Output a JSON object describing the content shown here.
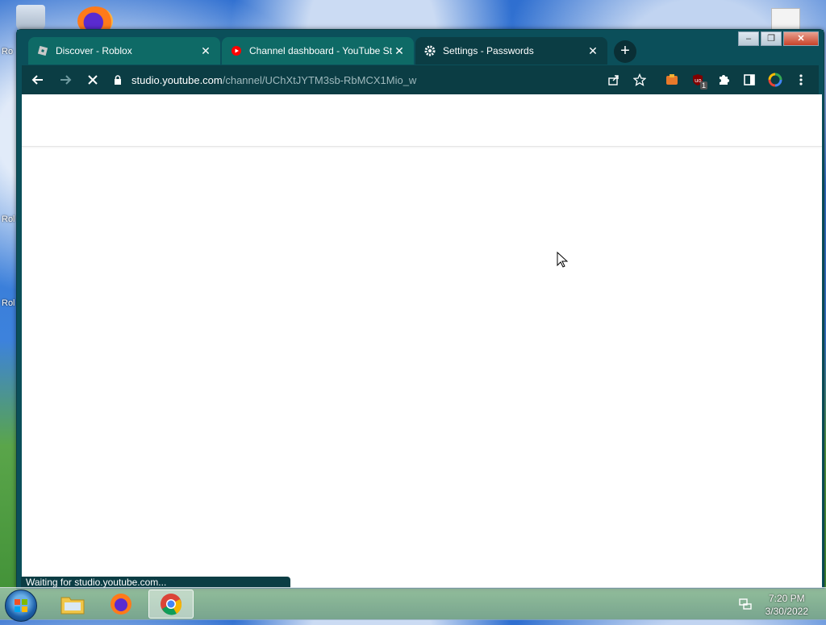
{
  "tabs": [
    {
      "title": "Discover - Roblox",
      "favicon": "roblox-icon",
      "active": false
    },
    {
      "title": "Channel dashboard - YouTube St",
      "favicon": "youtube-studio-icon",
      "active": false
    },
    {
      "title": "Settings - Passwords",
      "favicon": "gear-icon",
      "active": true
    }
  ],
  "toolbar": {
    "url_host": "studio.youtube.com",
    "url_path": "/channel/UChXtJYTM3sb-RbMCX1Mio_w",
    "extension_badge": "1"
  },
  "status": {
    "text": "Waiting for studio.youtube.com..."
  },
  "taskbar": {
    "time": "7:20 PM",
    "date": "3/30/2022",
    "items": [
      "windows-explorer-icon",
      "firefox-icon",
      "chrome-icon"
    ]
  },
  "desktop": {
    "side_labels": [
      "Ro",
      "Rol",
      "Rol"
    ]
  },
  "colors": {
    "frame": "#0b4f5a",
    "toolbar": "#0b3d44",
    "inactive_tab": "#0e6a66"
  }
}
